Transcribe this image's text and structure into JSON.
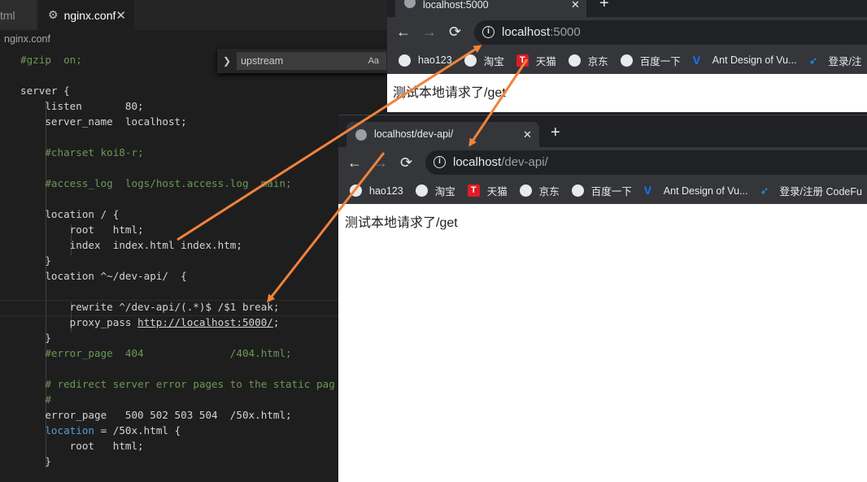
{
  "editor": {
    "tabs": [
      {
        "label": "tml"
      },
      {
        "label": "nginx.conf"
      }
    ],
    "breadcrumb": "nginx.conf",
    "find": {
      "value": "upstream",
      "option_label": "Aa"
    },
    "code": [
      [
        {
          "t": "#gzip  on;",
          "c": "cmt"
        }
      ],
      [],
      [
        {
          "t": "server {"
        }
      ],
      [
        {
          "t": "    listen       80;"
        }
      ],
      [
        {
          "t": "    server_name  localhost;"
        }
      ],
      [],
      [
        {
          "t": "    "
        },
        {
          "t": "#charset koi8-r;",
          "c": "cmt"
        }
      ],
      [],
      [
        {
          "t": "    "
        },
        {
          "t": "#access_log  logs/host.access.log  main;",
          "c": "cmt"
        }
      ],
      [],
      [
        {
          "t": "    location / {"
        }
      ],
      [
        {
          "t": "        root   html;"
        }
      ],
      [
        {
          "t": "        index  index.html index.htm;"
        }
      ],
      [
        {
          "t": "    }"
        }
      ],
      [
        {
          "t": "    location ^~/dev-api/  {"
        }
      ],
      [],
      [
        {
          "t": "        rewrite ^/dev-api/(.*)$ /$1 break;"
        }
      ],
      [
        {
          "t": "        proxy_pass "
        },
        {
          "t": "http://localhost:5000/",
          "c": "u"
        },
        {
          "t": ";"
        }
      ],
      [
        {
          "t": "    }"
        }
      ],
      [
        {
          "t": "    "
        },
        {
          "t": "#error_page  404              /404.html;",
          "c": "cmt"
        }
      ],
      [],
      [
        {
          "t": "    "
        },
        {
          "t": "# redirect server error pages to the static pag",
          "c": "cmt"
        }
      ],
      [
        {
          "t": "    "
        },
        {
          "t": "#",
          "c": "cmt"
        }
      ],
      [
        {
          "t": "    error_page   500 502 503 504  /50x.html;"
        }
      ],
      [
        {
          "t": "    "
        },
        {
          "t": "location",
          "c": "kw"
        },
        {
          "t": " = /50x.html {"
        }
      ],
      [
        {
          "t": "        root   html;"
        }
      ],
      [
        {
          "t": "    }"
        }
      ]
    ]
  },
  "browser1": {
    "tab_title": "localhost:5000",
    "close": "✕",
    "new_tab": "+",
    "url_host": "localhost",
    "url_path": ":5000",
    "content": "测试本地请求了/get"
  },
  "browser2": {
    "tab_title": "localhost/dev-api/",
    "close": "✕",
    "new_tab": "+",
    "url_host": "localhost",
    "url_path": "/dev-api/",
    "content": "测试本地请求了/get"
  },
  "bookmarks1": [
    {
      "label": "hao123",
      "icon": "globe-icon"
    },
    {
      "label": "淘宝",
      "icon": "globe-icon"
    },
    {
      "label": "天猫",
      "icon": "tmall-icon"
    },
    {
      "label": "京东",
      "icon": "globe-icon"
    },
    {
      "label": "百度一下",
      "icon": "globe-icon"
    },
    {
      "label": "Ant Design of Vu...",
      "icon": "antd-icon"
    },
    {
      "label": "登录/注",
      "icon": "codefun-icon"
    }
  ],
  "bookmarks2": [
    {
      "label": "hao123",
      "icon": "globe-icon"
    },
    {
      "label": "淘宝",
      "icon": "globe-icon"
    },
    {
      "label": "天猫",
      "icon": "tmall-icon"
    },
    {
      "label": "京东",
      "icon": "globe-icon"
    },
    {
      "label": "百度一下",
      "icon": "globe-icon"
    },
    {
      "label": "Ant Design of Vu...",
      "icon": "antd-icon"
    },
    {
      "label": "登录/注册 CodeFu",
      "icon": "codefun-icon"
    }
  ],
  "colors": {
    "arrow": "#f0833a",
    "comment": "#6a9955",
    "keyword": "#569cd6"
  }
}
